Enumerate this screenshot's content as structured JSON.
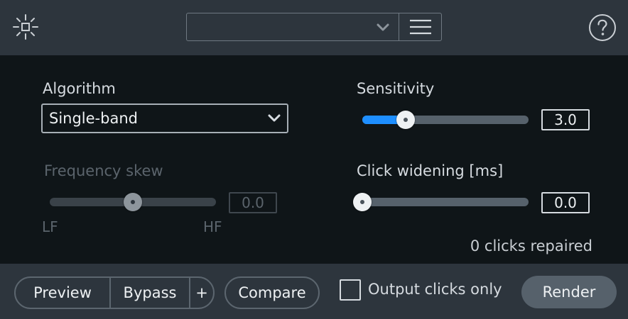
{
  "header": {
    "module_icon": "sun-settings-icon",
    "preset_value": "",
    "preset_dropdown_icon": "chevron-down-icon",
    "preset_menu_icon": "hamburger-menu-icon",
    "help_icon": "help-circle-icon"
  },
  "algorithm": {
    "label": "Algorithm",
    "selected": "Single-band"
  },
  "frequency_skew": {
    "label": "Frequency skew",
    "value": "0.0",
    "min_label": "LF",
    "max_label": "HF",
    "enabled": false,
    "level": 0.5
  },
  "sensitivity": {
    "label": "Sensitivity",
    "value": "3.0",
    "level": 0.26
  },
  "click_widening": {
    "label": "Click widening [ms]",
    "value": "0.0",
    "level": 0
  },
  "status": {
    "text": "0 clicks repaired"
  },
  "footer": {
    "preview_label": "Preview",
    "bypass_label": "Bypass",
    "add_label": "+",
    "compare_label": "Compare",
    "output_clicks_label": "Output clicks only",
    "output_clicks_checked": false,
    "render_label": "Render"
  },
  "colors": {
    "accent": "#1e8fff",
    "panel": "#2d353d",
    "background": "#0f1518"
  }
}
